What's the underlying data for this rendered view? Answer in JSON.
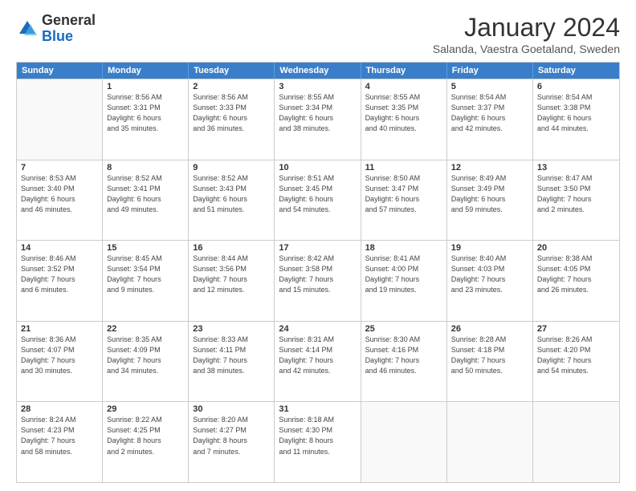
{
  "logo": {
    "general": "General",
    "blue": "Blue"
  },
  "title": "January 2024",
  "subtitle": "Salanda, Vaestra Goetaland, Sweden",
  "header_days": [
    "Sunday",
    "Monday",
    "Tuesday",
    "Wednesday",
    "Thursday",
    "Friday",
    "Saturday"
  ],
  "weeks": [
    [
      {
        "day": "",
        "empty": true
      },
      {
        "day": "1",
        "info": "Sunrise: 8:56 AM\nSunset: 3:31 PM\nDaylight: 6 hours\nand 35 minutes."
      },
      {
        "day": "2",
        "info": "Sunrise: 8:56 AM\nSunset: 3:33 PM\nDaylight: 6 hours\nand 36 minutes."
      },
      {
        "day": "3",
        "info": "Sunrise: 8:55 AM\nSunset: 3:34 PM\nDaylight: 6 hours\nand 38 minutes."
      },
      {
        "day": "4",
        "info": "Sunrise: 8:55 AM\nSunset: 3:35 PM\nDaylight: 6 hours\nand 40 minutes."
      },
      {
        "day": "5",
        "info": "Sunrise: 8:54 AM\nSunset: 3:37 PM\nDaylight: 6 hours\nand 42 minutes."
      },
      {
        "day": "6",
        "info": "Sunrise: 8:54 AM\nSunset: 3:38 PM\nDaylight: 6 hours\nand 44 minutes."
      }
    ],
    [
      {
        "day": "7",
        "info": "Sunrise: 8:53 AM\nSunset: 3:40 PM\nDaylight: 6 hours\nand 46 minutes."
      },
      {
        "day": "8",
        "info": "Sunrise: 8:52 AM\nSunset: 3:41 PM\nDaylight: 6 hours\nand 49 minutes."
      },
      {
        "day": "9",
        "info": "Sunrise: 8:52 AM\nSunset: 3:43 PM\nDaylight: 6 hours\nand 51 minutes."
      },
      {
        "day": "10",
        "info": "Sunrise: 8:51 AM\nSunset: 3:45 PM\nDaylight: 6 hours\nand 54 minutes."
      },
      {
        "day": "11",
        "info": "Sunrise: 8:50 AM\nSunset: 3:47 PM\nDaylight: 6 hours\nand 57 minutes."
      },
      {
        "day": "12",
        "info": "Sunrise: 8:49 AM\nSunset: 3:49 PM\nDaylight: 6 hours\nand 59 minutes."
      },
      {
        "day": "13",
        "info": "Sunrise: 8:47 AM\nSunset: 3:50 PM\nDaylight: 7 hours\nand 2 minutes."
      }
    ],
    [
      {
        "day": "14",
        "info": "Sunrise: 8:46 AM\nSunset: 3:52 PM\nDaylight: 7 hours\nand 6 minutes."
      },
      {
        "day": "15",
        "info": "Sunrise: 8:45 AM\nSunset: 3:54 PM\nDaylight: 7 hours\nand 9 minutes."
      },
      {
        "day": "16",
        "info": "Sunrise: 8:44 AM\nSunset: 3:56 PM\nDaylight: 7 hours\nand 12 minutes."
      },
      {
        "day": "17",
        "info": "Sunrise: 8:42 AM\nSunset: 3:58 PM\nDaylight: 7 hours\nand 15 minutes."
      },
      {
        "day": "18",
        "info": "Sunrise: 8:41 AM\nSunset: 4:00 PM\nDaylight: 7 hours\nand 19 minutes."
      },
      {
        "day": "19",
        "info": "Sunrise: 8:40 AM\nSunset: 4:03 PM\nDaylight: 7 hours\nand 23 minutes."
      },
      {
        "day": "20",
        "info": "Sunrise: 8:38 AM\nSunset: 4:05 PM\nDaylight: 7 hours\nand 26 minutes."
      }
    ],
    [
      {
        "day": "21",
        "info": "Sunrise: 8:36 AM\nSunset: 4:07 PM\nDaylight: 7 hours\nand 30 minutes."
      },
      {
        "day": "22",
        "info": "Sunrise: 8:35 AM\nSunset: 4:09 PM\nDaylight: 7 hours\nand 34 minutes."
      },
      {
        "day": "23",
        "info": "Sunrise: 8:33 AM\nSunset: 4:11 PM\nDaylight: 7 hours\nand 38 minutes."
      },
      {
        "day": "24",
        "info": "Sunrise: 8:31 AM\nSunset: 4:14 PM\nDaylight: 7 hours\nand 42 minutes."
      },
      {
        "day": "25",
        "info": "Sunrise: 8:30 AM\nSunset: 4:16 PM\nDaylight: 7 hours\nand 46 minutes."
      },
      {
        "day": "26",
        "info": "Sunrise: 8:28 AM\nSunset: 4:18 PM\nDaylight: 7 hours\nand 50 minutes."
      },
      {
        "day": "27",
        "info": "Sunrise: 8:26 AM\nSunset: 4:20 PM\nDaylight: 7 hours\nand 54 minutes."
      }
    ],
    [
      {
        "day": "28",
        "info": "Sunrise: 8:24 AM\nSunset: 4:23 PM\nDaylight: 7 hours\nand 58 minutes."
      },
      {
        "day": "29",
        "info": "Sunrise: 8:22 AM\nSunset: 4:25 PM\nDaylight: 8 hours\nand 2 minutes."
      },
      {
        "day": "30",
        "info": "Sunrise: 8:20 AM\nSunset: 4:27 PM\nDaylight: 8 hours\nand 7 minutes."
      },
      {
        "day": "31",
        "info": "Sunrise: 8:18 AM\nSunset: 4:30 PM\nDaylight: 8 hours\nand 11 minutes."
      },
      {
        "day": "",
        "empty": true
      },
      {
        "day": "",
        "empty": true
      },
      {
        "day": "",
        "empty": true
      }
    ]
  ]
}
